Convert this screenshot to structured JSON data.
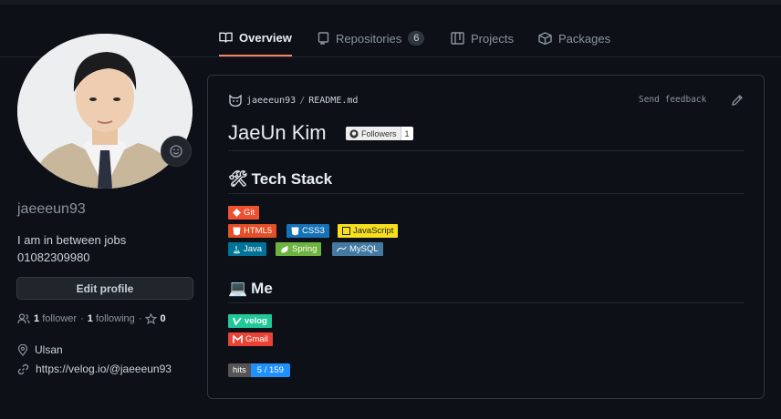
{
  "tabs": [
    {
      "label": "Overview"
    },
    {
      "label": "Repositories",
      "count": "6"
    },
    {
      "label": "Projects"
    },
    {
      "label": "Packages"
    }
  ],
  "profile": {
    "username": "jaeeeun93",
    "bio_line1": "I am in between jobs",
    "bio_line2": "01082309980",
    "edit_label": "Edit profile",
    "followers_count": "1",
    "followers_label": "follower",
    "following_count": "1",
    "following_label": "following",
    "stars_count": "0",
    "location": "Ulsan",
    "website": "https://velog.io/@jaeeeun93"
  },
  "readme": {
    "owner": "jaeeeun93",
    "separator": "/",
    "file": "README.md",
    "feedback": "Send feedback",
    "title": "JaeUn Kim",
    "followers_badge_label": "Followers",
    "followers_badge_value": "1",
    "tech_heading": "Tech Stack",
    "tech_emoji": "🛠",
    "me_heading": "Me",
    "me_emoji": "💻",
    "badges": {
      "git": "Git",
      "html5": "HTML5",
      "css3": "CSS3",
      "javascript": "JavaScript",
      "java": "Java",
      "spring": "Spring",
      "mysql": "MySQL",
      "velog": "velog",
      "gmail": "Gmail"
    },
    "hits_label": "hits",
    "hits_value": "5 / 159"
  },
  "colors": {
    "accent": "#f78166",
    "git": "#f05032",
    "html5": "#e34f26",
    "css3": "#1572b6",
    "javascript": "#f7df1e",
    "java": "#007396",
    "spring": "#6db33f",
    "mysql": "#4479a1",
    "velog": "#20c997",
    "gmail": "#ea4335",
    "hits_value": "#1e90ff"
  }
}
